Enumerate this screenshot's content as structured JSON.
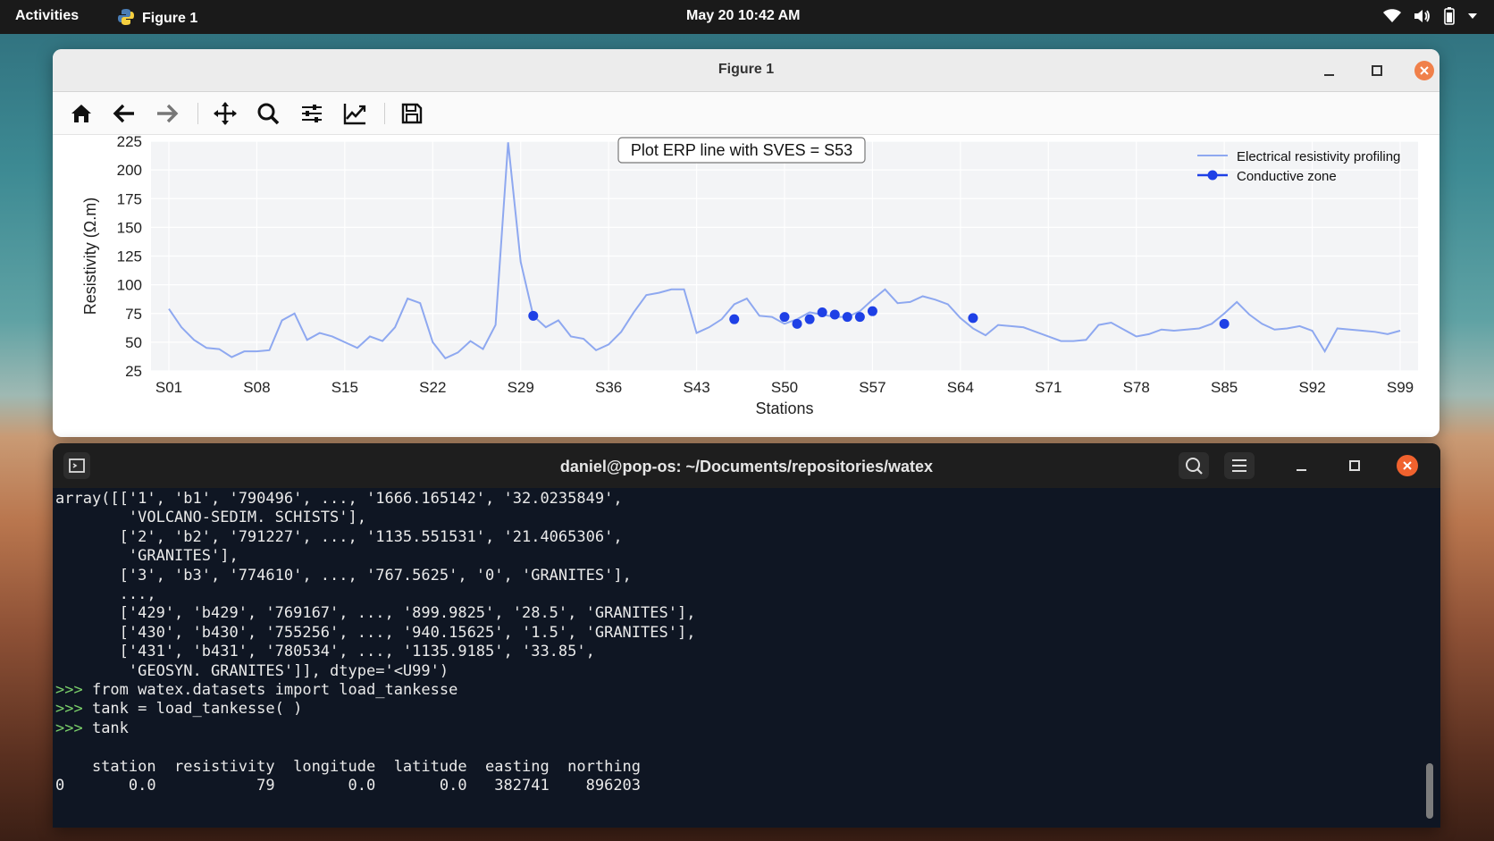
{
  "topbar": {
    "activities": "Activities",
    "app_name": "Figure 1",
    "clock": "May 20  10:42 AM"
  },
  "figure_window": {
    "title": "Figure 1",
    "toolbar": [
      "home-icon",
      "back-icon",
      "forward-icon",
      "pan-icon",
      "zoom-icon",
      "configure-icon",
      "edit-curves-icon",
      "save-icon"
    ]
  },
  "chart_data": {
    "type": "line",
    "title": "Plot ERP line with SVES = S53",
    "xlabel": "Stations",
    "ylabel": "Resistivity (Ω.m)",
    "ylim": [
      25,
      225
    ],
    "yticks": [
      "25",
      "50",
      "75",
      "100",
      "125",
      "150",
      "175",
      "200",
      "225"
    ],
    "xticks": [
      {
        "label": "S01",
        "station": 1
      },
      {
        "label": "S08",
        "station": 8
      },
      {
        "label": "S15",
        "station": 15
      },
      {
        "label": "S22",
        "station": 22
      },
      {
        "label": "S29",
        "station": 29
      },
      {
        "label": "S36",
        "station": 36
      },
      {
        "label": "S43",
        "station": 43
      },
      {
        "label": "S50",
        "station": 50
      },
      {
        "label": "S57",
        "station": 57
      },
      {
        "label": "S64",
        "station": 64
      },
      {
        "label": "S71",
        "station": 71
      },
      {
        "label": "S78",
        "station": 78
      },
      {
        "label": "S85",
        "station": 85
      },
      {
        "label": "S92",
        "station": 92
      },
      {
        "label": "S99",
        "station": 99
      }
    ],
    "grid": true,
    "legend_position": "top-right",
    "series": [
      {
        "name": "Electrical resistivity profiling",
        "color": "#8ea8f0",
        "values": [
          79,
          63,
          52,
          45,
          44,
          37,
          42,
          42,
          43,
          69,
          75,
          52,
          58,
          55,
          50,
          45,
          55,
          51,
          63,
          88,
          84,
          50,
          36,
          41,
          51,
          44,
          65,
          224,
          120,
          73,
          63,
          69,
          55,
          53,
          43,
          48,
          59,
          76,
          91,
          93,
          96,
          96,
          58,
          63,
          70,
          83,
          88,
          73,
          72,
          66,
          70,
          76,
          74,
          72,
          72,
          77,
          87,
          96,
          84,
          85,
          90,
          87,
          83,
          71,
          62,
          56,
          65,
          64,
          63,
          59,
          55,
          51,
          51,
          52,
          65,
          67,
          61,
          55,
          57,
          61,
          60,
          61,
          62,
          66,
          75,
          85,
          74,
          66,
          61,
          62,
          64,
          60,
          42,
          62,
          61,
          60,
          59,
          57,
          60
        ]
      },
      {
        "name": "Conductive zone",
        "color": "#1e40e6",
        "points": [
          [
            30,
            73
          ],
          [
            46,
            70
          ],
          [
            50,
            72
          ],
          [
            51,
            66
          ],
          [
            52,
            70
          ],
          [
            53,
            76
          ],
          [
            54,
            74
          ],
          [
            55,
            72
          ],
          [
            56,
            72
          ],
          [
            57,
            77
          ],
          [
            65,
            71
          ],
          [
            85,
            66
          ]
        ]
      }
    ]
  },
  "terminal": {
    "title": "daniel@pop-os: ~/Documents/repositories/watex",
    "lines": [
      {
        "prompt": "",
        "text": "array([['1', 'b1', '790496', ..., '1666.165142', '32.0235849',"
      },
      {
        "prompt": "",
        "text": "        'VOLCANO-SEDIM. SCHISTS'],"
      },
      {
        "prompt": "",
        "text": "       ['2', 'b2', '791227', ..., '1135.551531', '21.4065306',"
      },
      {
        "prompt": "",
        "text": "        'GRANITES'],"
      },
      {
        "prompt": "",
        "text": "       ['3', 'b3', '774610', ..., '767.5625', '0', 'GRANITES'],"
      },
      {
        "prompt": "",
        "text": "       ...,"
      },
      {
        "prompt": "",
        "text": "       ['429', 'b429', '769167', ..., '899.9825', '28.5', 'GRANITES'],"
      },
      {
        "prompt": "",
        "text": "       ['430', 'b430', '755256', ..., '940.15625', '1.5', 'GRANITES'],"
      },
      {
        "prompt": "",
        "text": "       ['431', 'b431', '780534', ..., '1135.9185', '33.85',"
      },
      {
        "prompt": "",
        "text": "        'GEOSYN. GRANITES']], dtype='<U99')"
      },
      {
        "prompt": ">>> ",
        "text": "from watex.datasets import load_tankesse"
      },
      {
        "prompt": ">>> ",
        "text": "tank = load_tankesse( )"
      },
      {
        "prompt": ">>> ",
        "text": "tank"
      },
      {
        "prompt": "",
        "text": ""
      },
      {
        "prompt": "",
        "text": "    station  resistivity  longitude  latitude  easting  northing"
      },
      {
        "prompt": "",
        "text": "0       0.0           79        0.0       0.0   382741    896203"
      }
    ]
  }
}
